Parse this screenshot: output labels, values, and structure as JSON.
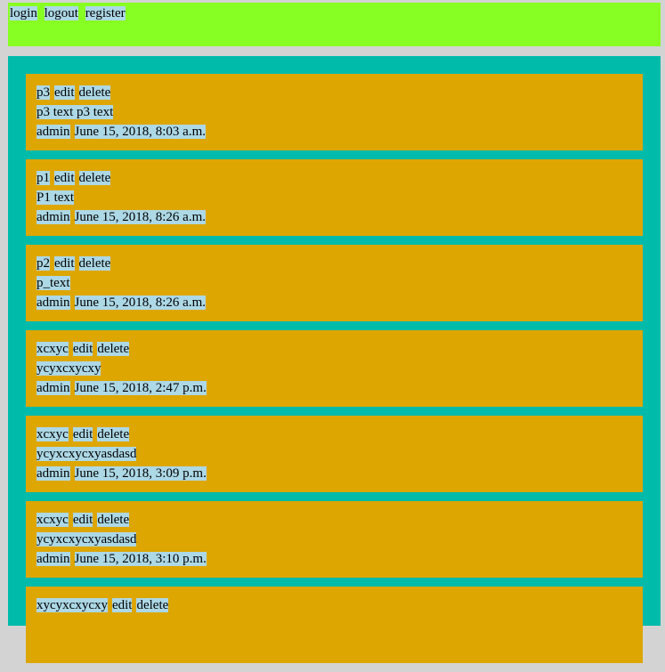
{
  "header": {
    "nav": [
      "login",
      "logout",
      "register"
    ]
  },
  "posts": [
    {
      "title": "p3",
      "edit": "edit",
      "delete": "delete",
      "text": "p3 text p3 text",
      "author": "admin",
      "date": "June 15, 2018, 8:03 a.m."
    },
    {
      "title": "p1",
      "edit": "edit",
      "delete": "delete",
      "text": "P1 text",
      "author": "admin",
      "date": "June 15, 2018, 8:26 a.m."
    },
    {
      "title": "p2",
      "edit": "edit",
      "delete": "delete",
      "text": "p_text",
      "author": "admin",
      "date": "June 15, 2018, 8:26 a.m."
    },
    {
      "title": "xcxyc",
      "edit": "edit",
      "delete": "delete",
      "text": "ycyxcxycxy",
      "author": "admin",
      "date": "June 15, 2018, 2:47 p.m."
    },
    {
      "title": "xcxyc",
      "edit": "edit",
      "delete": "delete",
      "text": "ycyxcxycxyasdasd",
      "author": "admin",
      "date": "June 15, 2018, 3:09 p.m."
    },
    {
      "title": "xcxyc",
      "edit": "edit",
      "delete": "delete",
      "text": "ycyxcxycxyasdasd",
      "author": "admin",
      "date": "June 15, 2018, 3:10 p.m."
    },
    {
      "title": "xycyxcxycxy",
      "edit": "edit",
      "delete": "delete",
      "text": "",
      "author": "",
      "date": ""
    }
  ],
  "colors": {
    "page_bg": "#d3d3d3",
    "header_bg": "#88ff22",
    "main_bg": "#00bbaa",
    "post_bg": "#dda600",
    "text_highlight": "#add8e6"
  }
}
